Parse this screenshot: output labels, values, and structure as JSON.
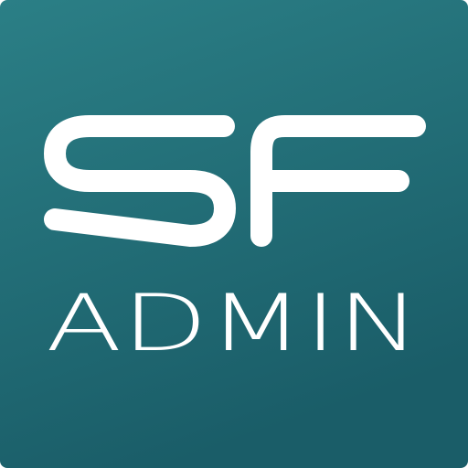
{
  "app_icon": {
    "logo_text": "SF",
    "subtitle": "ADMIN"
  },
  "colors": {
    "background_top": "#2b7f86",
    "background_bottom": "#1a5d68",
    "foreground": "#ffffff"
  }
}
